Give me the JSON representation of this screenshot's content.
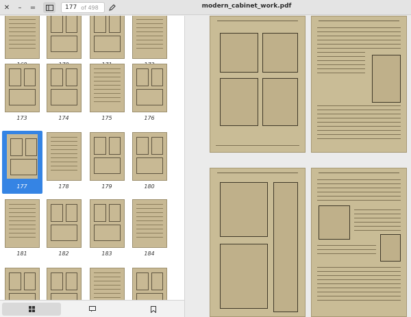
{
  "header": {
    "close_icon": "close-x-icon",
    "minimize_icon": "minimize-icon",
    "maximize_icon": "maximize-icon",
    "sidebar_toggle_icon": "sidebar-icon",
    "current_page": "177",
    "page_count": "(0 of 498)",
    "page_count_display": "of 498",
    "edit_icon": "pencil-icon",
    "title": "modern_cabinet_work.pdf",
    "search_icon": "search-icon",
    "menu_icon": "hamburger-icon"
  },
  "sidebar": {
    "thumbnails": [
      {
        "label": "169"
      },
      {
        "label": "170"
      },
      {
        "label": "171"
      },
      {
        "label": "172"
      },
      {
        "label": "173"
      },
      {
        "label": "174"
      },
      {
        "label": "175"
      },
      {
        "label": "176"
      },
      {
        "label": "177",
        "selected": true
      },
      {
        "label": "178"
      },
      {
        "label": "179"
      },
      {
        "label": "180"
      },
      {
        "label": "181"
      },
      {
        "label": "182"
      },
      {
        "label": "183"
      },
      {
        "label": "184"
      },
      {
        "label": ""
      },
      {
        "label": ""
      },
      {
        "label": ""
      },
      {
        "label": ""
      }
    ],
    "tabs": [
      {
        "icon": "grid-thumbnails-icon",
        "glyph": "▦",
        "active": true
      },
      {
        "icon": "outline-annotations-icon",
        "glyph": "▭",
        "active": false
      },
      {
        "icon": "bookmark-icon",
        "glyph": "⚐",
        "active": false
      }
    ]
  },
  "colors": {
    "accent": "#3584e4",
    "page_paper": "#c9bc96"
  }
}
